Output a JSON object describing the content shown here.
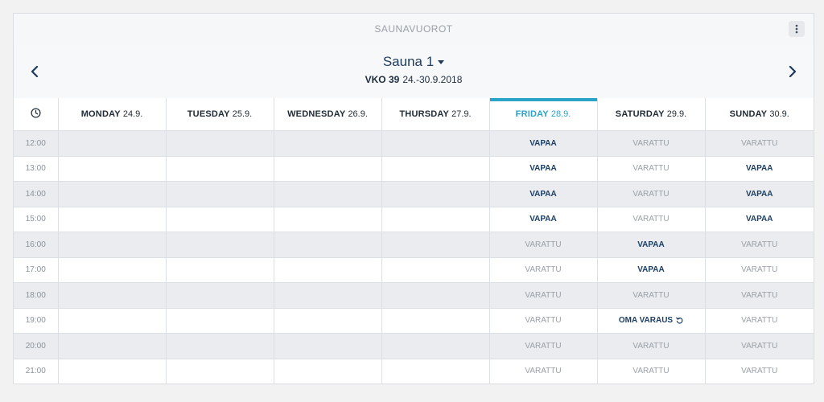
{
  "app": {
    "title": "SAUNAVUOROT"
  },
  "nav": {
    "sauna": "Sauna 1",
    "week_label": "VKO 39",
    "week_range": "24.-30.9.2018"
  },
  "colors": {
    "accent": "#2aa3c9",
    "free": "#1c3f66",
    "taken": "#9aa0a8"
  },
  "days": [
    {
      "name": "MONDAY",
      "date": "24.9.",
      "today": false
    },
    {
      "name": "TUESDAY",
      "date": "25.9.",
      "today": false
    },
    {
      "name": "WEDNESDAY",
      "date": "26.9.",
      "today": false
    },
    {
      "name": "THURSDAY",
      "date": "27.9.",
      "today": false
    },
    {
      "name": "FRIDAY",
      "date": "28.9.",
      "today": true
    },
    {
      "name": "SATURDAY",
      "date": "29.9.",
      "today": false
    },
    {
      "name": "SUNDAY",
      "date": "30.9.",
      "today": false
    }
  ],
  "rows": [
    {
      "time": "12:00",
      "cells": [
        "",
        "",
        "",
        "",
        "VAPAA",
        "VARATTU",
        "VARATTU"
      ]
    },
    {
      "time": "13:00",
      "cells": [
        "",
        "",
        "",
        "",
        "VAPAA",
        "VARATTU",
        "VAPAA"
      ]
    },
    {
      "time": "14:00",
      "cells": [
        "",
        "",
        "",
        "",
        "VAPAA",
        "VARATTU",
        "VAPAA"
      ]
    },
    {
      "time": "15:00",
      "cells": [
        "",
        "",
        "",
        "",
        "VAPAA",
        "VARATTU",
        "VAPAA"
      ]
    },
    {
      "time": "16:00",
      "cells": [
        "",
        "",
        "",
        "",
        "VARATTU",
        "VAPAA",
        "VARATTU"
      ]
    },
    {
      "time": "17:00",
      "cells": [
        "",
        "",
        "",
        "",
        "VARATTU",
        "VAPAA",
        "VARATTU"
      ]
    },
    {
      "time": "18:00",
      "cells": [
        "",
        "",
        "",
        "",
        "VARATTU",
        "VARATTU",
        "VARATTU"
      ]
    },
    {
      "time": "19:00",
      "cells": [
        "",
        "",
        "",
        "",
        "VARATTU",
        "OMA VARAUS",
        "VARATTU"
      ]
    },
    {
      "time": "20:00",
      "cells": [
        "",
        "",
        "",
        "",
        "VARATTU",
        "VARATTU",
        "VARATTU"
      ]
    },
    {
      "time": "21:00",
      "cells": [
        "",
        "",
        "",
        "",
        "VARATTU",
        "VARATTU",
        "VARATTU"
      ]
    }
  ],
  "status_types": {
    "free": "VAPAA",
    "taken": "VARATTU",
    "own": "OMA VARAUS"
  }
}
